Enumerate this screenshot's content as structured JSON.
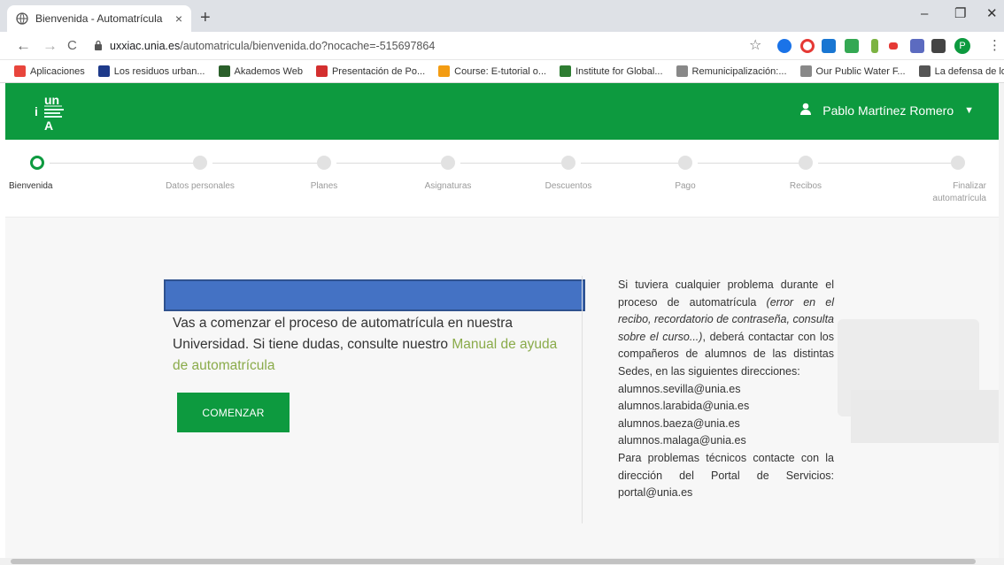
{
  "browser": {
    "tab_title": "Bienvenida - Automatrícula",
    "tab_close": "×",
    "new_tab": "+",
    "minimize": "–",
    "restore": "❐",
    "close": "✕",
    "back": "←",
    "forward": "→",
    "reload": "C",
    "url_host": "uxxiac.unia.es",
    "url_path": "/automatricula/bienvenida.do?nocache=-515697864",
    "star": "☆",
    "more": "⋮",
    "profile_initial": "P",
    "bookmarks_more": "»",
    "bookmarks": [
      {
        "label": "Aplicaciones",
        "color": "#e8453c"
      },
      {
        "label": "Los residuos urban...",
        "color": "#1e3a8a"
      },
      {
        "label": "Akademos Web",
        "color": "#2a5f2a"
      },
      {
        "label": "Presentación de Po...",
        "color": "#d32f2f"
      },
      {
        "label": "Course: E-tutorial o...",
        "color": "#f39c12"
      },
      {
        "label": "Institute for Global...",
        "color": "#2e7d32"
      },
      {
        "label": "Remunicipalización:...",
        "color": "#888888"
      },
      {
        "label": "Our Public Water F...",
        "color": "#888888"
      },
      {
        "label": "La defensa de los s...",
        "color": "#555555"
      }
    ]
  },
  "header": {
    "logo_top": "un",
    "logo_bottom": "A",
    "logo_letter": "i",
    "user_name": "Pablo Martínez Romero",
    "caret": "▼"
  },
  "steps": [
    {
      "label": "Bienvenida",
      "active": true
    },
    {
      "label": "Datos personales",
      "active": false
    },
    {
      "label": "Planes",
      "active": false
    },
    {
      "label": "Asignaturas",
      "active": false
    },
    {
      "label": "Descuentos",
      "active": false
    },
    {
      "label": "Pago",
      "active": false
    },
    {
      "label": "Recibos",
      "active": false
    },
    {
      "label": "Finalizar automatrícula",
      "active": false
    }
  ],
  "main": {
    "intro_text": "Vas a comenzar el proceso de automatrícula en nuestra Universidad. Si tiene dudas, consulte nuestro ",
    "manual_link": "Manual de ayuda de automatrícula",
    "start_button": "COMENZAR"
  },
  "help": {
    "intro": "Si tuviera cualquier problema durante el proceso de automatrícula ",
    "intro_examples": "(error en el recibo, recordatorio de contraseña, consulta sobre el curso...)",
    "intro_end": ", deberá contactar con los compañeros de alumnos de las distintas Sedes, en las siguientes direcciones:",
    "emails": [
      "alumnos.sevilla@unia.es",
      "alumnos.larabida@unia.es",
      "alumnos.baeza@unia.es",
      "alumnos.malaga@unia.es"
    ],
    "tech_text": "Para problemas técnicos contacte con la dirección del Portal de Servicios:",
    "tech_email": "portal@unia.es"
  },
  "colors": {
    "brand_green": "#0d9a3f",
    "link_green": "#8aab4a",
    "blue_box": "#4472c4"
  }
}
